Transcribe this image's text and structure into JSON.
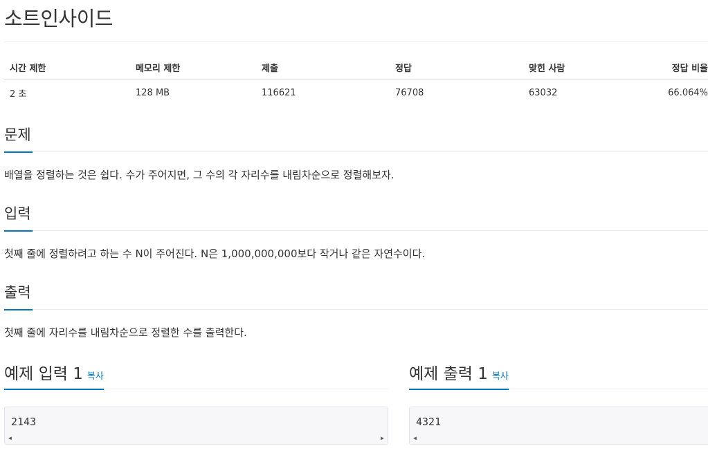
{
  "problem": {
    "title": "소트인사이드"
  },
  "stats": {
    "headers": [
      "시간 제한",
      "메모리 제한",
      "제출",
      "정답",
      "맞힌 사람",
      "정답 비율"
    ],
    "values": [
      "2 초",
      "128 MB",
      "116621",
      "76708",
      "63032",
      "66.064%"
    ]
  },
  "description": {
    "heading": "문제",
    "text": "배열을 정렬하는 것은 쉽다. 수가 주어지면, 그 수의 각 자리수를 내림차순으로 정렬해보자."
  },
  "input": {
    "heading": "입력",
    "text": "첫째 줄에 정렬하려고 하는 수 N이 주어진다. N은 1,000,000,000보다 작거나 같은 자연수이다."
  },
  "output": {
    "heading": "출력",
    "text": "첫째 줄에 자리수를 내림차순으로 정렬한 수를 출력한다."
  },
  "sample_input": {
    "heading": "예제 입력 1",
    "copy_label": "복사",
    "code": "2143"
  },
  "sample_output": {
    "heading": "예제 출력 1",
    "copy_label": "복사",
    "code": "4321"
  },
  "scroll_arrows": {
    "left": "◀",
    "right": "▶"
  },
  "colors": {
    "accent": "#0076c0",
    "text": "#333333",
    "code_bg": "#f7f7f9"
  }
}
